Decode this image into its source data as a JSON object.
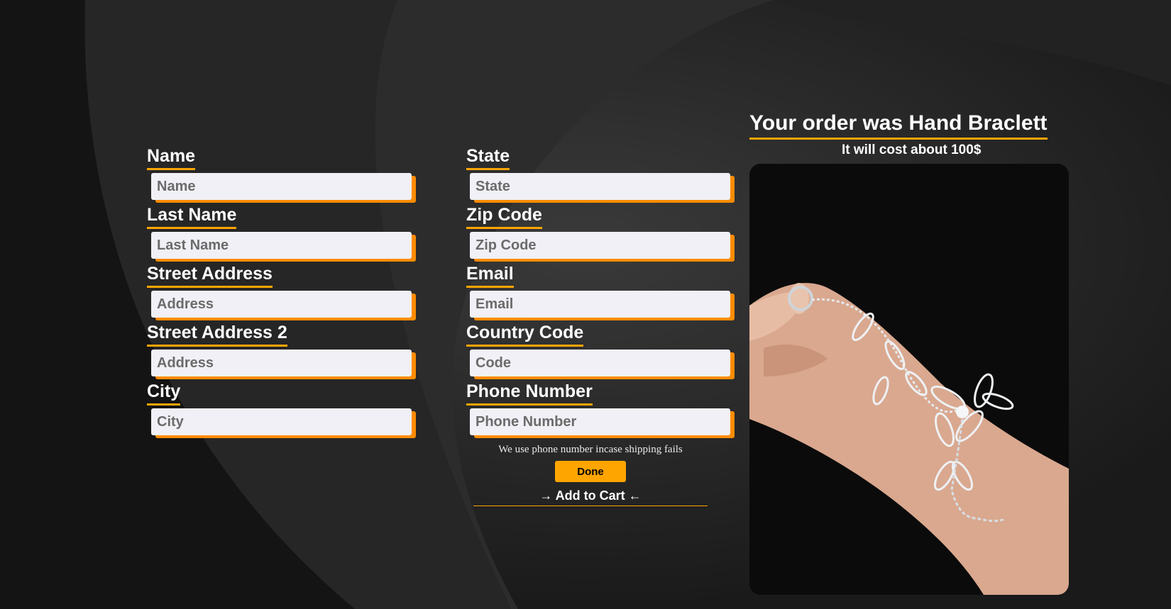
{
  "form": {
    "left_column": [
      {
        "label": "Name",
        "placeholder": "Name"
      },
      {
        "label": "Last Name",
        "placeholder": "Last Name"
      },
      {
        "label": "Street Address",
        "placeholder": "Address"
      },
      {
        "label": "Street Address 2",
        "placeholder": "Address"
      },
      {
        "label": "City",
        "placeholder": "City"
      }
    ],
    "right_column": [
      {
        "label": "State",
        "placeholder": "State"
      },
      {
        "label": "Zip Code",
        "placeholder": "Zip Code"
      },
      {
        "label": "Email",
        "placeholder": "Email"
      },
      {
        "label": "Country Code",
        "placeholder": "Code"
      },
      {
        "label": "Phone Number",
        "placeholder": "Phone Number"
      }
    ],
    "phone_note": "We use phone number incase shipping fails",
    "done_label": "Done",
    "add_to_cart_label": "→ Add to Cart ←"
  },
  "order": {
    "title": "Your order was Hand Braclett",
    "cost": "It will cost about 100$"
  },
  "colors": {
    "accent": "#ffa500",
    "shadow": "#ff8c00",
    "background": "#1c1c1c",
    "input_bg": "#f0f0f6"
  }
}
